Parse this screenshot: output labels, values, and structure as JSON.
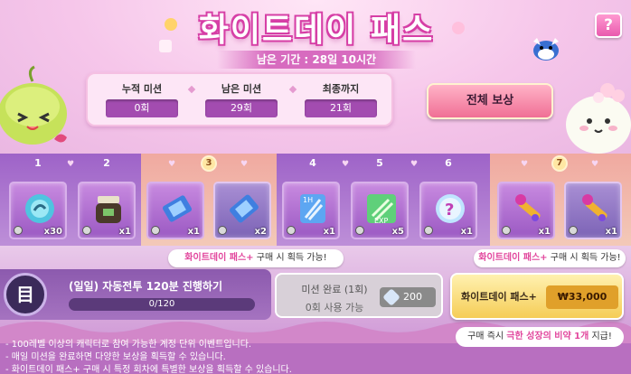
{
  "header": {
    "title": "화이트데이 패스",
    "remaining": "남은 기간 : 28일 10시간",
    "help_label": "?"
  },
  "stats": [
    {
      "label": "누적 미션",
      "value": "0회"
    },
    {
      "label": "남은 미션",
      "value": "29회"
    },
    {
      "label": "최종까지",
      "value": "21회"
    }
  ],
  "all_reward_label": "전체 보상",
  "groups": {
    "numbers": [
      "1",
      "2",
      "3",
      "4",
      "5",
      "6",
      "7"
    ]
  },
  "rewards": [
    {
      "name": "blue-orb",
      "qty": "x30"
    },
    {
      "name": "jar",
      "qty": "x1"
    },
    {
      "name": "blue-ticket",
      "qty": "x1"
    },
    {
      "name": "blue-ticket-2",
      "qty": "x2"
    },
    {
      "name": "1h-crystal",
      "qty": "x1"
    },
    {
      "name": "exp-coupon",
      "qty": "x5"
    },
    {
      "name": "mystery-orb",
      "qty": "x1"
    },
    {
      "name": "gold-key",
      "qty": "x1"
    },
    {
      "name": "gold-key-2",
      "qty": "x1"
    }
  ],
  "tips": {
    "left_highlight": "화이트데이 패스+",
    "left_text": " 구매 시 획득 가능!",
    "right_highlight": "화이트데이 패스+",
    "right_text": " 구매 시 획득 가능!"
  },
  "mission": {
    "icon": "目",
    "text": "(일일) 자동전투 120분 진행하기",
    "progress": "0/120",
    "progress_fraction": 0.0
  },
  "complete": {
    "label": "미션 완료 (1회)",
    "sub": "0회 사용 가능",
    "cost": "200"
  },
  "buy": {
    "label": "화이트데이 패스+",
    "price": "₩33,000"
  },
  "buy_note": {
    "prefix": "구매 즉시 ",
    "highlight": "극한 성장의 비약 1개",
    "suffix": " 지급!"
  },
  "footer_lines": [
    "- 100레벨 이상의 캐릭터로 참여 가능한 계정 단위 이벤트입니다.",
    "- 매일 미션을 완료하면 다양한 보상을 획득할 수 있습니다.",
    "- 화이트데이 패스+ 구매 시 특정 회차에 특별한 보상을 획득할 수 있습니다."
  ],
  "colors": {
    "accent_pink": "#e2479d",
    "purple": "#9b59c3",
    "gold": "#f5cd57"
  }
}
